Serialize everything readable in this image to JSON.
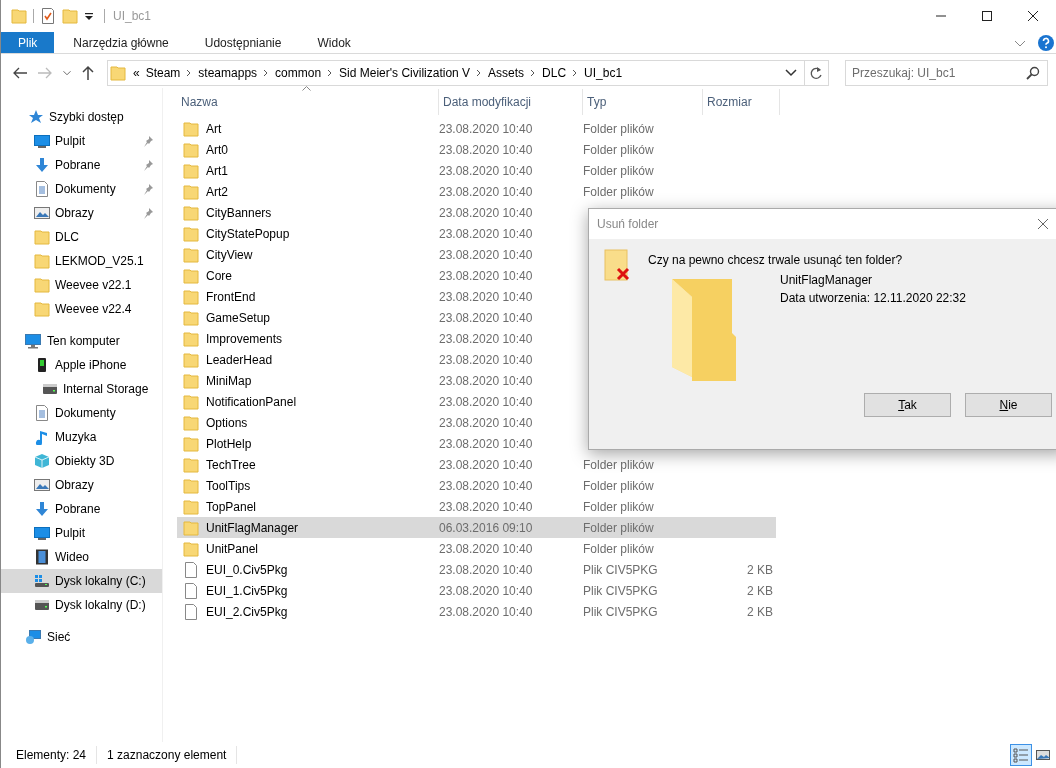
{
  "window": {
    "title": "UI_bc1"
  },
  "ribbon": {
    "tabs": [
      {
        "label": "Plik",
        "kind": "file"
      },
      {
        "label": "Narzędzia główne",
        "kind": "tab"
      },
      {
        "label": "Udostępnianie",
        "kind": "tab"
      },
      {
        "label": "Widok",
        "kind": "tab"
      }
    ]
  },
  "address_bar": {
    "overflow": "«",
    "path": [
      "Steam",
      "steamapps",
      "common",
      "Sid Meier's Civilization V",
      "Assets",
      "DLC",
      "UI_bc1"
    ]
  },
  "search": {
    "placeholder": "Przeszukaj: UI_bc1"
  },
  "sidebar": {
    "items": [
      {
        "label": "Szybki dostęp",
        "kind": "star",
        "selected": false,
        "children": [
          {
            "label": "Pulpit",
            "kind": "desktop",
            "pinned": true,
            "selected": false
          },
          {
            "label": "Pobrane",
            "kind": "download",
            "pinned": true,
            "selected": false
          },
          {
            "label": "Dokumenty",
            "kind": "document",
            "pinned": true,
            "selected": false
          },
          {
            "label": "Obrazy",
            "kind": "pictures",
            "pinned": true,
            "selected": false
          },
          {
            "label": "DLC",
            "kind": "folder",
            "pinned": false,
            "selected": false
          },
          {
            "label": "LEKMOD_V25.1",
            "kind": "folder",
            "pinned": false,
            "selected": false
          },
          {
            "label": "Weevee v22.1",
            "kind": "folder",
            "pinned": false,
            "selected": false
          },
          {
            "label": "Weevee v22.4",
            "kind": "folder",
            "pinned": false,
            "selected": false
          }
        ]
      },
      {
        "label": "Ten komputer",
        "kind": "computer",
        "selected": false,
        "children": [
          {
            "label": "Apple iPhone",
            "kind": "phone",
            "selected": false,
            "children": [
              {
                "label": "Internal Storage",
                "kind": "drive",
                "selected": false
              }
            ]
          },
          {
            "label": "Dokumenty",
            "kind": "document",
            "selected": false
          },
          {
            "label": "Muzyka",
            "kind": "music",
            "selected": false
          },
          {
            "label": "Obiekty 3D",
            "kind": "cube",
            "selected": false
          },
          {
            "label": "Obrazy",
            "kind": "pictures",
            "selected": false
          },
          {
            "label": "Pobrane",
            "kind": "download",
            "selected": false
          },
          {
            "label": "Pulpit",
            "kind": "desktop",
            "selected": false
          },
          {
            "label": "Wideo",
            "kind": "video",
            "selected": false
          },
          {
            "label": "Dysk lokalny (C:)",
            "kind": "windrive",
            "selected": true
          },
          {
            "label": "Dysk lokalny (D:)",
            "kind": "drive",
            "selected": false
          }
        ]
      },
      {
        "label": "Sieć",
        "kind": "network",
        "selected": false
      }
    ]
  },
  "file_list": {
    "columns": [
      {
        "label": "Nazwa",
        "sorted": true
      },
      {
        "label": "Data modyfikacji",
        "sorted": false
      },
      {
        "label": "Typ",
        "sorted": false
      },
      {
        "label": "Rozmiar",
        "sorted": false
      }
    ],
    "rows": [
      {
        "name": "Art",
        "modified": "23.08.2020 10:40",
        "type": "Folder plików",
        "kind": "folder",
        "selected": false
      },
      {
        "name": "Art0",
        "modified": "23.08.2020 10:40",
        "type": "Folder plików",
        "kind": "folder",
        "selected": false
      },
      {
        "name": "Art1",
        "modified": "23.08.2020 10:40",
        "type": "Folder plików",
        "kind": "folder",
        "selected": false
      },
      {
        "name": "Art2",
        "modified": "23.08.2020 10:40",
        "type": "Folder plików",
        "kind": "folder",
        "selected": false
      },
      {
        "name": "CityBanners",
        "modified": "23.08.2020 10:40",
        "kind": "folder",
        "selected": false
      },
      {
        "name": "CityStatePopup",
        "modified": "23.08.2020 10:40",
        "kind": "folder",
        "selected": false
      },
      {
        "name": "CityView",
        "modified": "23.08.2020 10:40",
        "kind": "folder",
        "selected": false
      },
      {
        "name": "Core",
        "modified": "23.08.2020 10:40",
        "kind": "folder",
        "selected": false
      },
      {
        "name": "FrontEnd",
        "modified": "23.08.2020 10:40",
        "kind": "folder",
        "selected": false
      },
      {
        "name": "GameSetup",
        "modified": "23.08.2020 10:40",
        "kind": "folder",
        "selected": false
      },
      {
        "name": "Improvements",
        "modified": "23.08.2020 10:40",
        "kind": "folder",
        "selected": false
      },
      {
        "name": "LeaderHead",
        "modified": "23.08.2020 10:40",
        "kind": "folder",
        "selected": false
      },
      {
        "name": "MiniMap",
        "modified": "23.08.2020 10:40",
        "kind": "folder",
        "selected": false
      },
      {
        "name": "NotificationPanel",
        "modified": "23.08.2020 10:40",
        "kind": "folder",
        "selected": false
      },
      {
        "name": "Options",
        "modified": "23.08.2020 10:40",
        "kind": "folder",
        "selected": false
      },
      {
        "name": "PlotHelp",
        "modified": "23.08.2020 10:40",
        "kind": "folder",
        "selected": false
      },
      {
        "name": "TechTree",
        "modified": "23.08.2020 10:40",
        "type": "Folder plików",
        "kind": "folder",
        "selected": false
      },
      {
        "name": "ToolTips",
        "modified": "23.08.2020 10:40",
        "type": "Folder plików",
        "kind": "folder",
        "selected": false
      },
      {
        "name": "TopPanel",
        "modified": "23.08.2020 10:40",
        "type": "Folder plików",
        "kind": "folder",
        "selected": false
      },
      {
        "name": "UnitFlagManager",
        "modified": "06.03.2016 09:10",
        "type": "Folder plików",
        "kind": "folder",
        "selected": true
      },
      {
        "name": "UnitPanel",
        "modified": "23.08.2020 10:40",
        "type": "Folder plików",
        "kind": "folder",
        "selected": false
      },
      {
        "name": "EUI_0.Civ5Pkg",
        "modified": "23.08.2020 10:40",
        "type": "Plik CIV5PKG",
        "size": "2 KB",
        "kind": "file",
        "selected": false
      },
      {
        "name": "EUI_1.Civ5Pkg",
        "modified": "23.08.2020 10:40",
        "type": "Plik CIV5PKG",
        "size": "2 KB",
        "kind": "file",
        "selected": false
      },
      {
        "name": "EUI_2.Civ5Pkg",
        "modified": "23.08.2020 10:40",
        "type": "Plik CIV5PKG",
        "size": "2 KB",
        "kind": "file",
        "selected": false
      }
    ]
  },
  "dialog": {
    "title": "Usuń folder",
    "question": "Czy na pewno chcesz trwale usunąć ten folder?",
    "item_name": "UnitFlagManager",
    "created": "Data utworzenia: 12.11.2020 22:32",
    "buttons": [
      {
        "label": "Tak",
        "underline_first": true
      },
      {
        "label": "Nie",
        "underline_first": true
      }
    ]
  },
  "status_bar": {
    "count": "Elementy: 24",
    "selection": "1 zaznaczony element",
    "views": [
      {
        "kind": "details",
        "selected": true
      },
      {
        "kind": "tiles",
        "selected": false
      }
    ]
  }
}
